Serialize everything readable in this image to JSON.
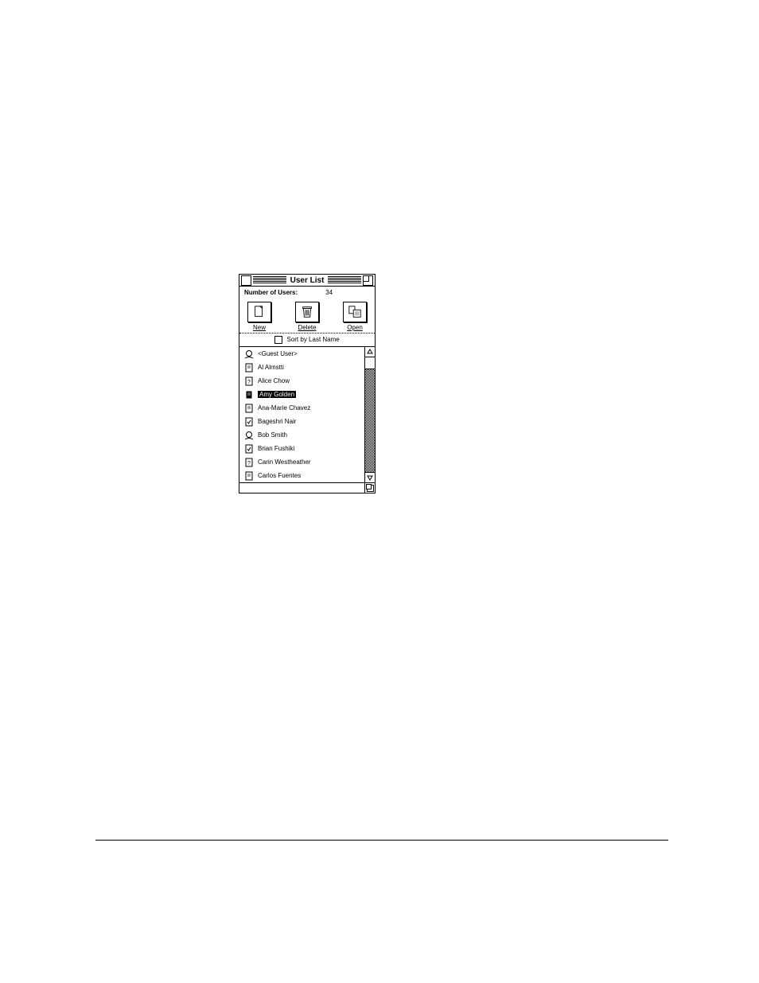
{
  "window": {
    "title": "User List",
    "info_label": "Number of Users:",
    "user_count": "34"
  },
  "toolbar": {
    "new_label": "New",
    "delete_label": "Delete",
    "open_label": "Open"
  },
  "sort": {
    "label": "Sort by Last Name"
  },
  "users": [
    {
      "name": "<Guest User>",
      "icon": "face",
      "selected": false
    },
    {
      "name": "Al Almstti",
      "icon": "doc",
      "selected": false
    },
    {
      "name": "Alice Chow",
      "icon": "doc-q",
      "selected": false
    },
    {
      "name": "Amy Golden",
      "icon": "doc",
      "selected": true
    },
    {
      "name": "Ana-Marie Chavez",
      "icon": "doc",
      "selected": false
    },
    {
      "name": "Bageshri Nair",
      "icon": "doc-chk",
      "selected": false
    },
    {
      "name": "Bob Smith",
      "icon": "face",
      "selected": false
    },
    {
      "name": "Brian Fushiki",
      "icon": "doc-chk",
      "selected": false
    },
    {
      "name": "Carin Westheather",
      "icon": "doc-q",
      "selected": false
    },
    {
      "name": "Carlos Fuentes",
      "icon": "doc",
      "selected": false
    }
  ]
}
